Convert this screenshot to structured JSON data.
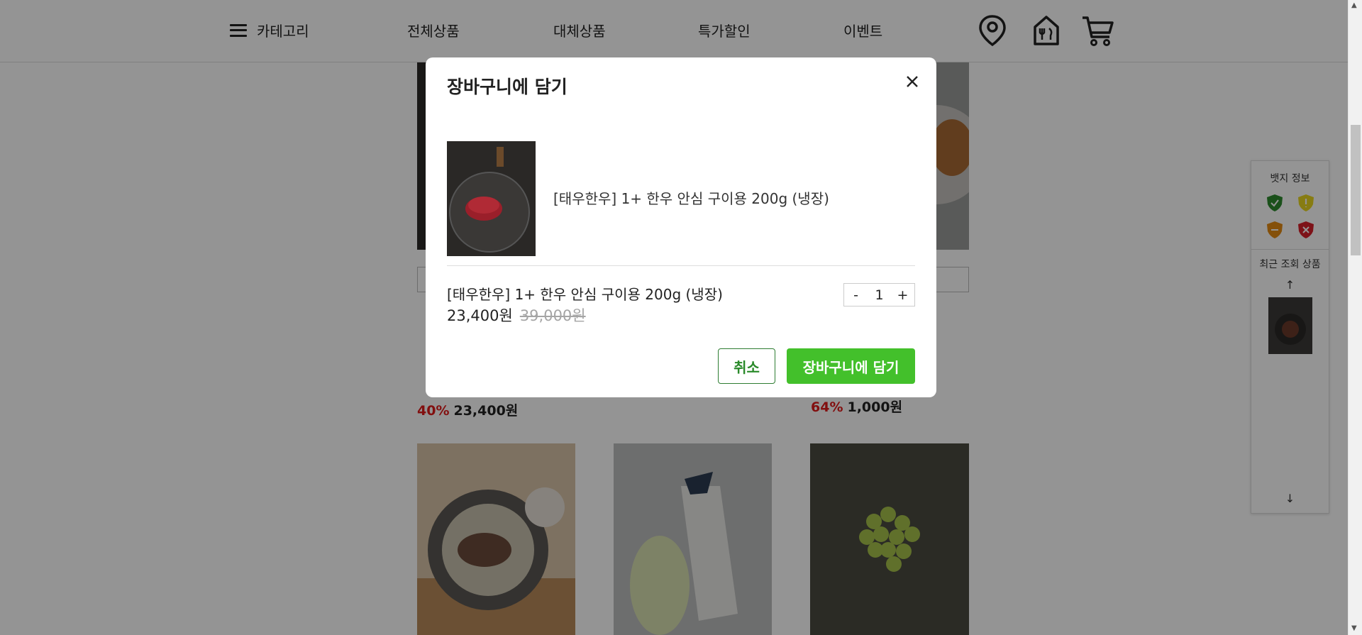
{
  "header": {
    "category_label": "카테고리",
    "nav": [
      "전체상품",
      "대체상품",
      "특가할인",
      "이벤트"
    ],
    "icons": [
      "location-pin-icon",
      "store-icon",
      "cart-icon"
    ]
  },
  "background": {
    "product_prices": [
      {
        "discount": "40%",
        "price": "23,400원"
      },
      {
        "discount": "64%",
        "price": "1,000원"
      }
    ]
  },
  "side_panel": {
    "badge_title": "뱃지 정보",
    "badge_colors": [
      "#2e8b2e",
      "#e8d620",
      "#e48a12",
      "#d8202a"
    ],
    "recent_title": "최근 조회 상품",
    "up_arrow": "↑",
    "down_arrow": "↓"
  },
  "modal": {
    "title": "장바구니에 담기",
    "close_icon": "close-icon",
    "product_name": "[태우한우] 1+ 한우 안심 구이용 200g (냉장)",
    "option_name": "[태우한우] 1+ 한우 안심 구이용 200g (냉장)",
    "price": "23,400원",
    "original_price": "39,000원",
    "quantity": "1",
    "minus": "-",
    "plus": "+",
    "cancel_label": "취소",
    "add_label": "장바구니에 담기"
  },
  "colors": {
    "accent_green": "#43c02b",
    "discount_red": "#e01a1a"
  }
}
